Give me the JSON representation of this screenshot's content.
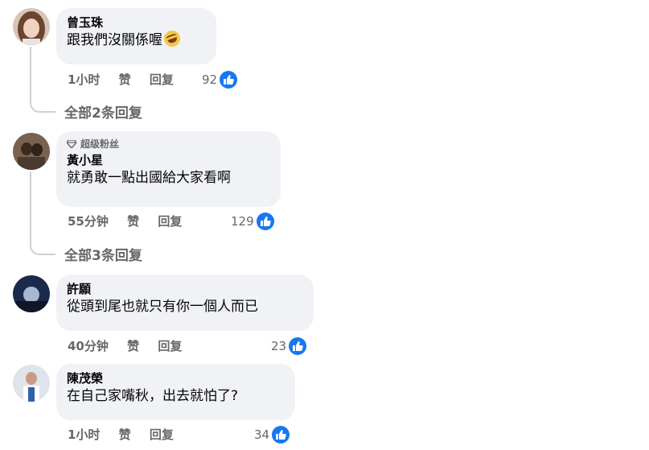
{
  "comments": [
    {
      "name": "曾玉珠",
      "text": "跟我們沒關係喔",
      "emoji": "rolling-laughing-emoji",
      "time": "1小时",
      "like_label": "赞",
      "reply_label": "回复",
      "likes": "92",
      "replies_link": "全部2条回复"
    },
    {
      "badge": "超级粉丝",
      "name": "黃小星",
      "text": "就勇敢一點出國給大家看啊",
      "time": "55分钟",
      "like_label": "赞",
      "reply_label": "回复",
      "likes": "129",
      "replies_link": "全部3条回复"
    },
    {
      "name": "許願",
      "text": "從頭到尾也就只有你一個人而已",
      "time": "40分钟",
      "like_label": "赞",
      "reply_label": "回复",
      "likes": "23"
    },
    {
      "name": "陳茂榮",
      "text": "在自己家嘴秋，出去就怕了?",
      "time": "1小时",
      "like_label": "赞",
      "reply_label": "回复",
      "likes": "34"
    }
  ],
  "colors": {
    "bubble": "#f0f2f5",
    "secondary_text": "#65676b",
    "like_blue": "#1877f2",
    "thread_line": "#ced0d4"
  }
}
